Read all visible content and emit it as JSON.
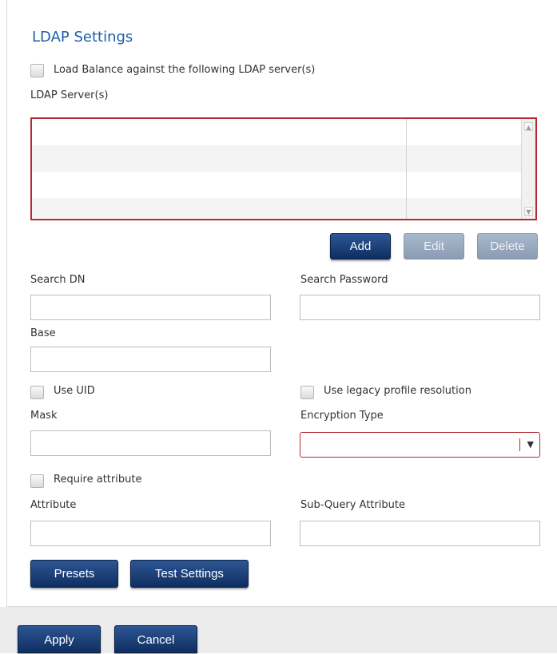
{
  "title": "LDAP Settings",
  "load_balance": {
    "label": "Load Balance against the following LDAP server(s)",
    "checked": false
  },
  "servers": {
    "label": "LDAP Server(s)",
    "rows": []
  },
  "server_buttons": {
    "add": "Add",
    "edit": "Edit",
    "delete": "Delete"
  },
  "fields": {
    "search_dn": {
      "label": "Search DN",
      "value": ""
    },
    "search_password": {
      "label": "Search Password",
      "value": ""
    },
    "base": {
      "label": "Base",
      "value": ""
    },
    "use_uid": {
      "label": "Use UID",
      "checked": false
    },
    "legacy_profile": {
      "label": "Use legacy profile resolution",
      "checked": false
    },
    "mask": {
      "label": "Mask",
      "value": ""
    },
    "encryption_type": {
      "label": "Encryption Type",
      "value": ""
    },
    "require_attribute": {
      "label": "Require attribute",
      "checked": false
    },
    "attribute": {
      "label": "Attribute",
      "value": ""
    },
    "sub_query_attribute": {
      "label": "Sub-Query Attribute",
      "value": ""
    }
  },
  "actions": {
    "presets": "Presets",
    "test_settings": "Test Settings"
  },
  "footer": {
    "apply": "Apply",
    "cancel": "Cancel"
  },
  "colors": {
    "accent": "#1f5ea8",
    "button": "#173a72",
    "error_border": "#b52a31"
  },
  "icons": {
    "scroll_up": "scroll-up-arrow-icon",
    "scroll_down": "scroll-down-arrow-icon",
    "dropdown": "chevron-down-icon"
  }
}
